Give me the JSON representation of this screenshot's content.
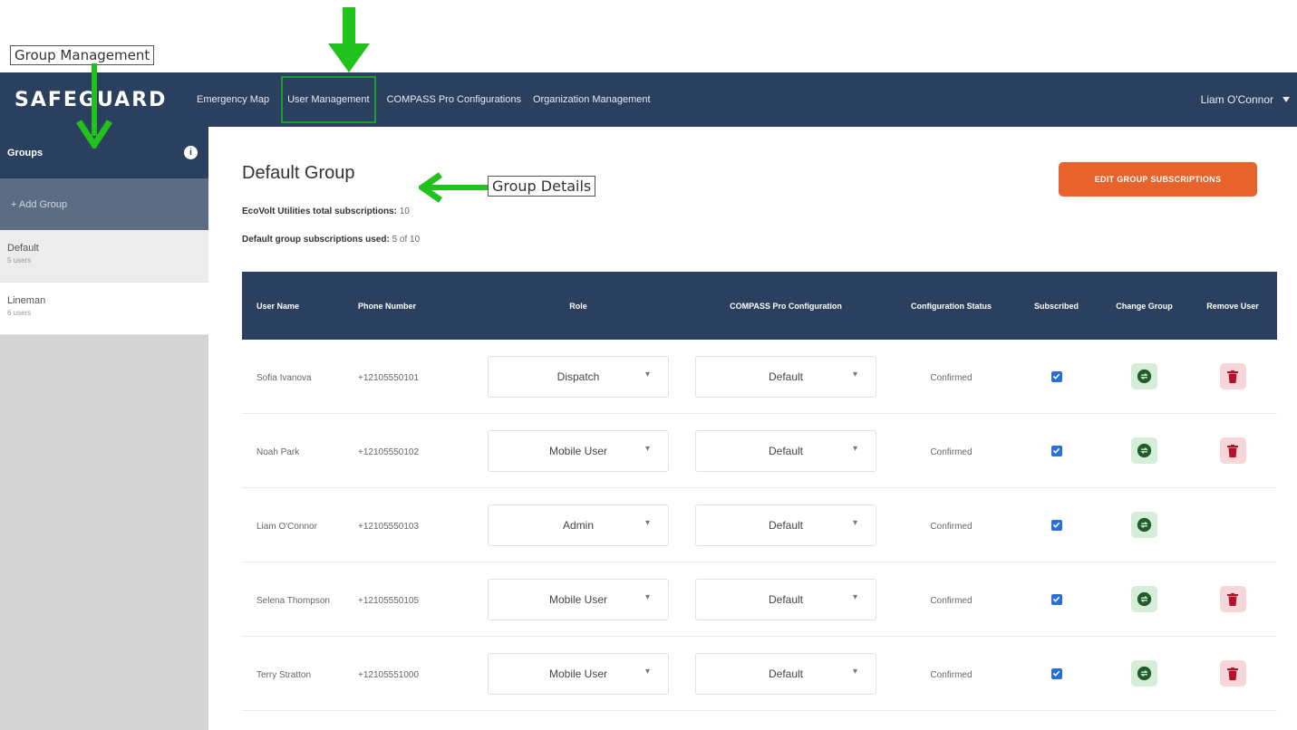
{
  "annotations": {
    "group_management": "Group Management",
    "group_details": "Group Details"
  },
  "nav": {
    "brand": "SAFEGUARD",
    "items": [
      "Emergency Map",
      "User Management",
      "COMPASS Pro Configurations",
      "Organization Management"
    ],
    "user": "Liam O'Connor"
  },
  "sidebar": {
    "header": "Groups",
    "info_icon": "i",
    "add_label": "+ Add Group",
    "groups": [
      {
        "name": "Default",
        "count": "5 users"
      },
      {
        "name": "Lineman",
        "count": "6 users"
      }
    ]
  },
  "main": {
    "title": "Default Group",
    "total_label": "EcoVolt Utilities total subscriptions:",
    "total_value": "10",
    "used_label": "Default group subscriptions used:",
    "used_value": "5 of 10",
    "edit_button": "Edit Group Subscriptions"
  },
  "table": {
    "headers": [
      "User Name",
      "Phone Number",
      "Role",
      "COMPASS Pro Configuration",
      "Configuration Status",
      "Subscribed",
      "Change Group",
      "Remove User"
    ],
    "rows": [
      {
        "name": "Sofia Ivanova",
        "phone": "+12105550101",
        "role": "Dispatch",
        "config": "Default",
        "status": "Confirmed",
        "subscribed": true,
        "removable": true
      },
      {
        "name": "Noah Park",
        "phone": "+12105550102",
        "role": "Mobile User",
        "config": "Default",
        "status": "Confirmed",
        "subscribed": true,
        "removable": true
      },
      {
        "name": "Liam O'Connor",
        "phone": "+12105550103",
        "role": "Admin",
        "config": "Default",
        "status": "Confirmed",
        "subscribed": true,
        "removable": false
      },
      {
        "name": "Selena Thompson",
        "phone": "+12105550105",
        "role": "Mobile User",
        "config": "Default",
        "status": "Confirmed",
        "subscribed": true,
        "removable": true
      },
      {
        "name": "Terry Stratton",
        "phone": "+12105551000",
        "role": "Mobile User",
        "config": "Default",
        "status": "Confirmed",
        "subscribed": true,
        "removable": true
      }
    ]
  },
  "colors": {
    "nav_bg": "#2b3f5e",
    "accent_orange": "#e8622c",
    "annotation_arrow": "#22c21c",
    "checkbox_blue": "#2a6fd6"
  },
  "icons": {
    "caret": "chevron-down-icon",
    "change_group": "swap-group-icon",
    "remove_user": "trash-icon",
    "subscribed": "checkbox-checked-icon"
  }
}
